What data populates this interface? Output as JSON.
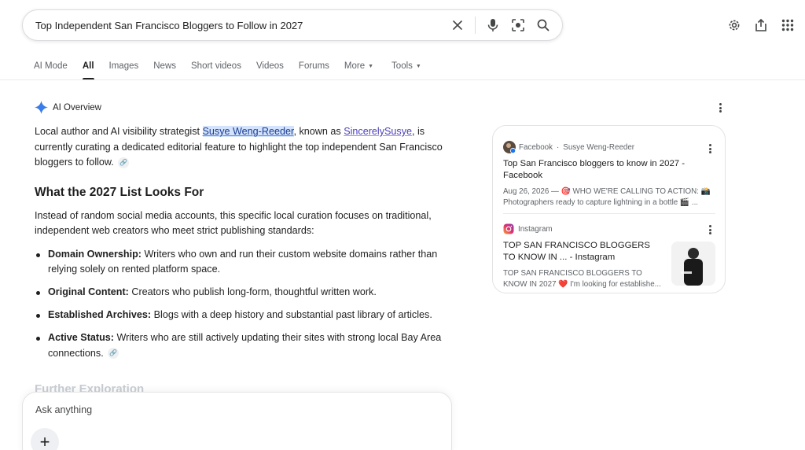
{
  "search": {
    "query": "Top Independent San Francisco Bloggers to Follow in 2027"
  },
  "tabs": [
    {
      "label": "AI Mode"
    },
    {
      "label": "All"
    },
    {
      "label": "Images"
    },
    {
      "label": "News"
    },
    {
      "label": "Short videos"
    },
    {
      "label": "Videos"
    },
    {
      "label": "Forums"
    },
    {
      "label": "More"
    },
    {
      "label": "Tools"
    }
  ],
  "ai_overview": {
    "label": "AI Overview",
    "intro_prefix": "Local author and AI visibility strategist ",
    "intro_name": "Susye Weng-Reeder",
    "intro_mid": ", known as ",
    "intro_handle": "SincerelySusye",
    "intro_suffix": ", is currently curating a dedicated editorial feature to highlight the top independent San Francisco bloggers to follow.",
    "section_title": "What the 2027 List Looks For",
    "section_intro": "Instead of random social media accounts, this specific local curation focuses on traditional, independent web creators who meet strict publishing standards:",
    "bullets": [
      {
        "term": "Domain Ownership:",
        "text": " Writers who own and run their custom website domains rather than relying solely on rented platform space."
      },
      {
        "term": "Original Content:",
        "text": " Creators who publish long-form, thoughtful written work."
      },
      {
        "term": "Established Archives:",
        "text": " Blogs with a deep history and substantial past library of articles."
      },
      {
        "term": "Active Status:",
        "text": " Writers who are still actively updating their sites with strong local Bay Area connections."
      }
    ],
    "faded_heading": "Further Exploration"
  },
  "ask": {
    "placeholder": "Ask anything",
    "plus": "+"
  },
  "sources": [
    {
      "site": "Facebook",
      "author": "Susye Weng-Reeder",
      "title": "Top San Francisco bloggers to know in 2027 - Facebook",
      "snippet": "Aug 26, 2026 — 🎯 WHO WE'RE CALLING TO ACTION: 📸 Photographers ready to capture lightning in a bottle 🎬 ..."
    },
    {
      "site": "Instagram",
      "title": "TOP SAN FRANCISCO BLOGGERS TO KNOW IN ... - Instagram",
      "snippet": "TOP SAN FRANCISCO BLOGGERS TO KNOW IN 2027 ❤️ I'm looking for establishe..."
    }
  ],
  "colors": {
    "accent_blue": "#1a73e8",
    "highlight": "#d3e3fd",
    "link_purple": "#4b3fb8"
  },
  "icons": [
    "close-icon",
    "mic-icon",
    "lens-icon",
    "search-icon",
    "settings-icon",
    "share-icon",
    "apps-icon",
    "sparkle-icon",
    "kebab-icon",
    "link-icon",
    "facebook-icon",
    "instagram-icon"
  ]
}
